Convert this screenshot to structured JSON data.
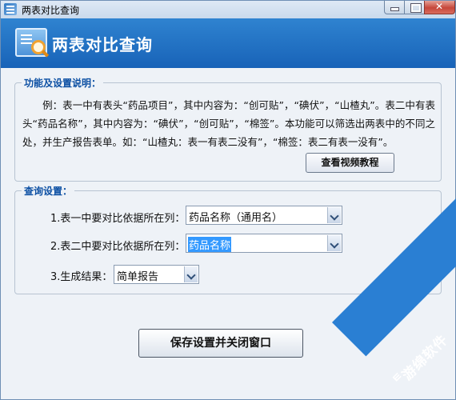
{
  "window": {
    "title": "两表对比查询"
  },
  "banner": {
    "title": "两表对比查询"
  },
  "info": {
    "legend": "功能及设置说明：",
    "text": "　　例：表一中有表头“药品项目”，其中内容为：“创可贴”，“碘伏”，“山楂丸”。表二中有表头“药品名称”，其中内容为：“碘伏”，“创可贴”，“棉签”。本功能可以筛选出两表中的不同之处，并生产报告表单。如：“山楂丸：表一有表二没有”，“棉签：表二有表一没有”。",
    "video_button": "查看视频教程"
  },
  "query": {
    "legend": "查询设置：",
    "row1_label": "1.表一中要对比依据所在列：",
    "row1_value": "药品名称（通用名）",
    "row2_label": "2.表二中要对比依据所在列：",
    "row2_value": "药品名称",
    "row3_label": "3.生成结果：",
    "row3_value": "简单报告"
  },
  "save_button": "保存设置并关闭窗口",
  "watermark": {
    "text": "游绵软件"
  }
}
